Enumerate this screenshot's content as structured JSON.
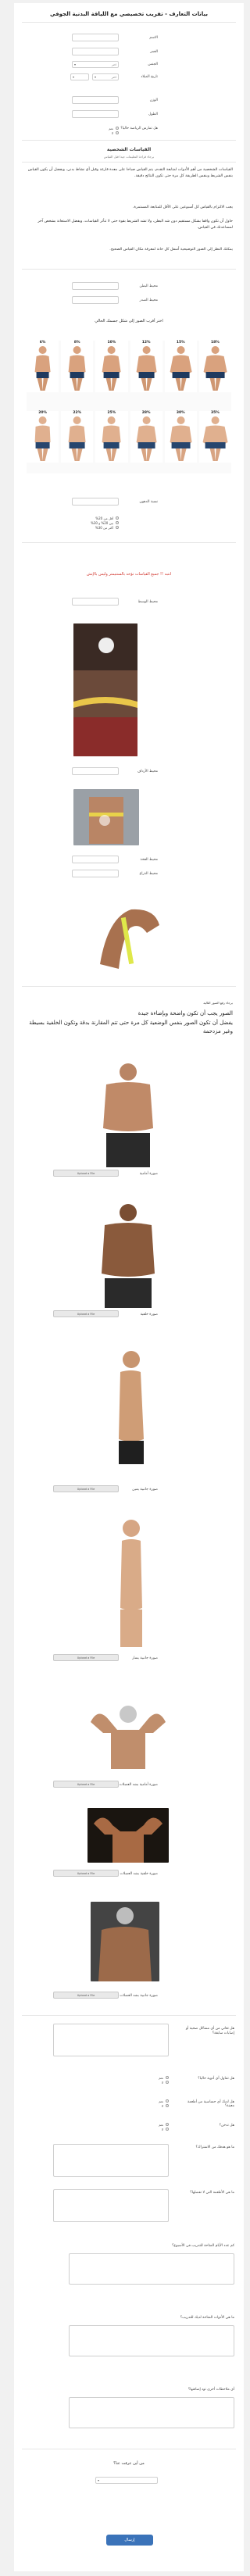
{
  "form": {
    "title": "بيانات التعارف - تفريب تخصيصي مع اللياقة البدنية الجوفي",
    "fields_top": [
      {
        "label": "الاسم"
      },
      {
        "label": "العمر"
      },
      {
        "label": "الجنس",
        "value": "اختر"
      },
      {
        "label": "تاريخ الميلاد",
        "value": "اختر"
      },
      {
        "label": "الوزن"
      },
      {
        "label": "الطول"
      },
      {
        "label": "هل تمارس الرياضة حاليا؟"
      }
    ],
    "yes_no": [
      "نعم",
      "لا"
    ],
    "section1_title": "القياسات الشخصية",
    "section1_sub": "برجاء قراءة التعليمات جيدا قبل القياس",
    "section1_para1": "القياسات الشخصية من أهم الأدوات لمتابعة التقدم، يتم القياس صباحا على معدة فارغة وقبل أي نشاط بدني، ويفضل أن يكون القياس بنفس الشريط وبنفس الطريقة كل مرة حتى تكون النتائج دقيقة.",
    "section1_para2": "يجب الالتزام بالقياس كل أسبوعين على الأقل للمتابعة المستمرة.",
    "section1_para3": "حاول أن تكون واقفا بشكل مستقيم دون شد البطن، ولا تشد الشريط بقوة حتى لا تتأثر القياسات، ويفضل الاستعانة بشخص آخر لمساعدتك في القياس.",
    "section1_para4": "يمكنك النظر إلى الصور التوضيحية أسفل كل خانة لمعرفة مكان القياس الصحيح.",
    "measure_fields": [
      {
        "label": "محيط البطن"
      },
      {
        "label": "محيط الصدر"
      }
    ],
    "bodyfat_prompt": "اختر أقرب الصور إلى شكل جسمك الحالي",
    "bodyfat_row1": [
      "6%",
      "8%",
      "10%",
      "12%",
      "15%",
      "18%"
    ],
    "bodyfat_row2": [
      "20%",
      "22%",
      "25%",
      "28%",
      "30%",
      "35%"
    ],
    "bodyfat_select_label": "نسبة الدهون",
    "bodyfat_options": [
      "أقل من 20%",
      "بين 20% و 30%",
      "أكثر من 30%"
    ],
    "red_notice": "انتبه !! جميع القياسات تؤخذ بالسنتيمتر وليس بالإنش",
    "measure_photo_fields": [
      {
        "label": "محيط الوسط"
      },
      {
        "label": "محيط الأرداف"
      },
      {
        "label": "محيط الفخذ"
      },
      {
        "label": "محيط الذراع"
      }
    ],
    "upload_intro_small": "برجاء رفع الصور التالية",
    "upload_intro_big1": "الصور يجب أن تكون واضحة وبإضاءة جيدة",
    "upload_intro_big2": "يفضل أن تكون الصور بنفس الوضعية كل مرة حتى تتم المقارنة بدقة وتكون الخلفية بسيطة وغير مزدحمة",
    "upload_btn": "Upload a File",
    "uploads": [
      {
        "label": "صورة أمامية"
      },
      {
        "label": "صورة خلفية"
      },
      {
        "label": "صورة جانبية يمين"
      },
      {
        "label": "صورة جانبية يسار"
      },
      {
        "label": "صورة أمامية بشد العضلات"
      },
      {
        "label": "صورة خلفية بشد العضلات"
      },
      {
        "label": "صورة جانبية بشد العضلات"
      }
    ],
    "q_textarea_1": "هل تعاني من أي مشاكل صحية أو إصابات سابقة؟",
    "q_radio_1": "هل تتناول أي أدوية حاليا؟",
    "q_radio_2": "هل لديك أي حساسية من أطعمة معينة؟",
    "q_radio_3": "هل تدخن؟",
    "q_textarea_2": "ما هو هدفك من الاشتراك؟",
    "q_textarea_3": "ما هي الأطعمة التي لا تفضلها؟",
    "q_textarea_4": "كم عدد الأيام المتاحة للتدريب في الأسبوع؟",
    "q_textarea_5": "ما هي الأدوات المتاحة لديك للتدريب؟",
    "q_textarea_6": "أي ملاحظات أخرى تود إضافتها؟",
    "final_question": "من أين عرفت عنا؟",
    "submit": "إرسال"
  },
  "colors": {
    "accent": "#3b73b9",
    "notice": "#d0342c"
  }
}
